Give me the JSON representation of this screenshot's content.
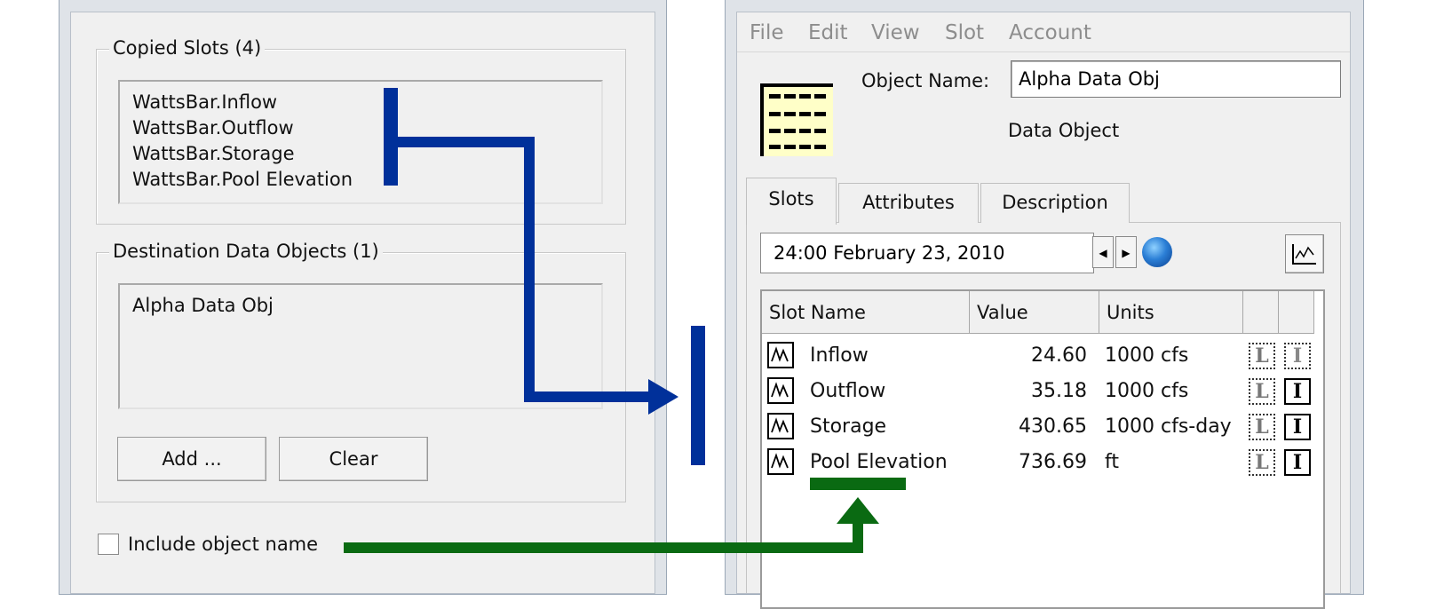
{
  "left_dialog": {
    "copied_slots": {
      "title": "Copied Slots (4)",
      "items": [
        "WattsBar.Inflow",
        "WattsBar.Outflow",
        "WattsBar.Storage",
        "WattsBar.Pool Elevation"
      ]
    },
    "destinations": {
      "title": "Destination Data Objects (1)",
      "items": [
        "Alpha Data Obj"
      ]
    },
    "buttons": {
      "add": "Add ...",
      "clear": "Clear"
    },
    "include_object_name": {
      "label": "Include object name",
      "checked": false
    }
  },
  "right_window": {
    "menu": [
      "File",
      "Edit",
      "View",
      "Slot",
      "Account"
    ],
    "object_name_label": "Object Name:",
    "object_name_value": "Alpha Data Obj",
    "object_type": "Data Object",
    "tabs": [
      "Slots",
      "Attributes",
      "Description"
    ],
    "active_tab": "Slots",
    "date": "24:00 February 23, 2010",
    "table": {
      "columns": [
        "Slot Name",
        "Value",
        "Units"
      ],
      "rows": [
        {
          "name": "Inflow",
          "value": "24.60",
          "units": "1000 cfs"
        },
        {
          "name": "Outflow",
          "value": "35.18",
          "units": "1000 cfs"
        },
        {
          "name": "Storage",
          "value": "430.65",
          "units": "1000 cfs-day"
        },
        {
          "name": "Pool Elevation",
          "value": "736.69",
          "units": "ft"
        }
      ]
    }
  },
  "colors": {
    "blue_arrow": "#00309a",
    "green_arrow": "#0a6a12"
  }
}
